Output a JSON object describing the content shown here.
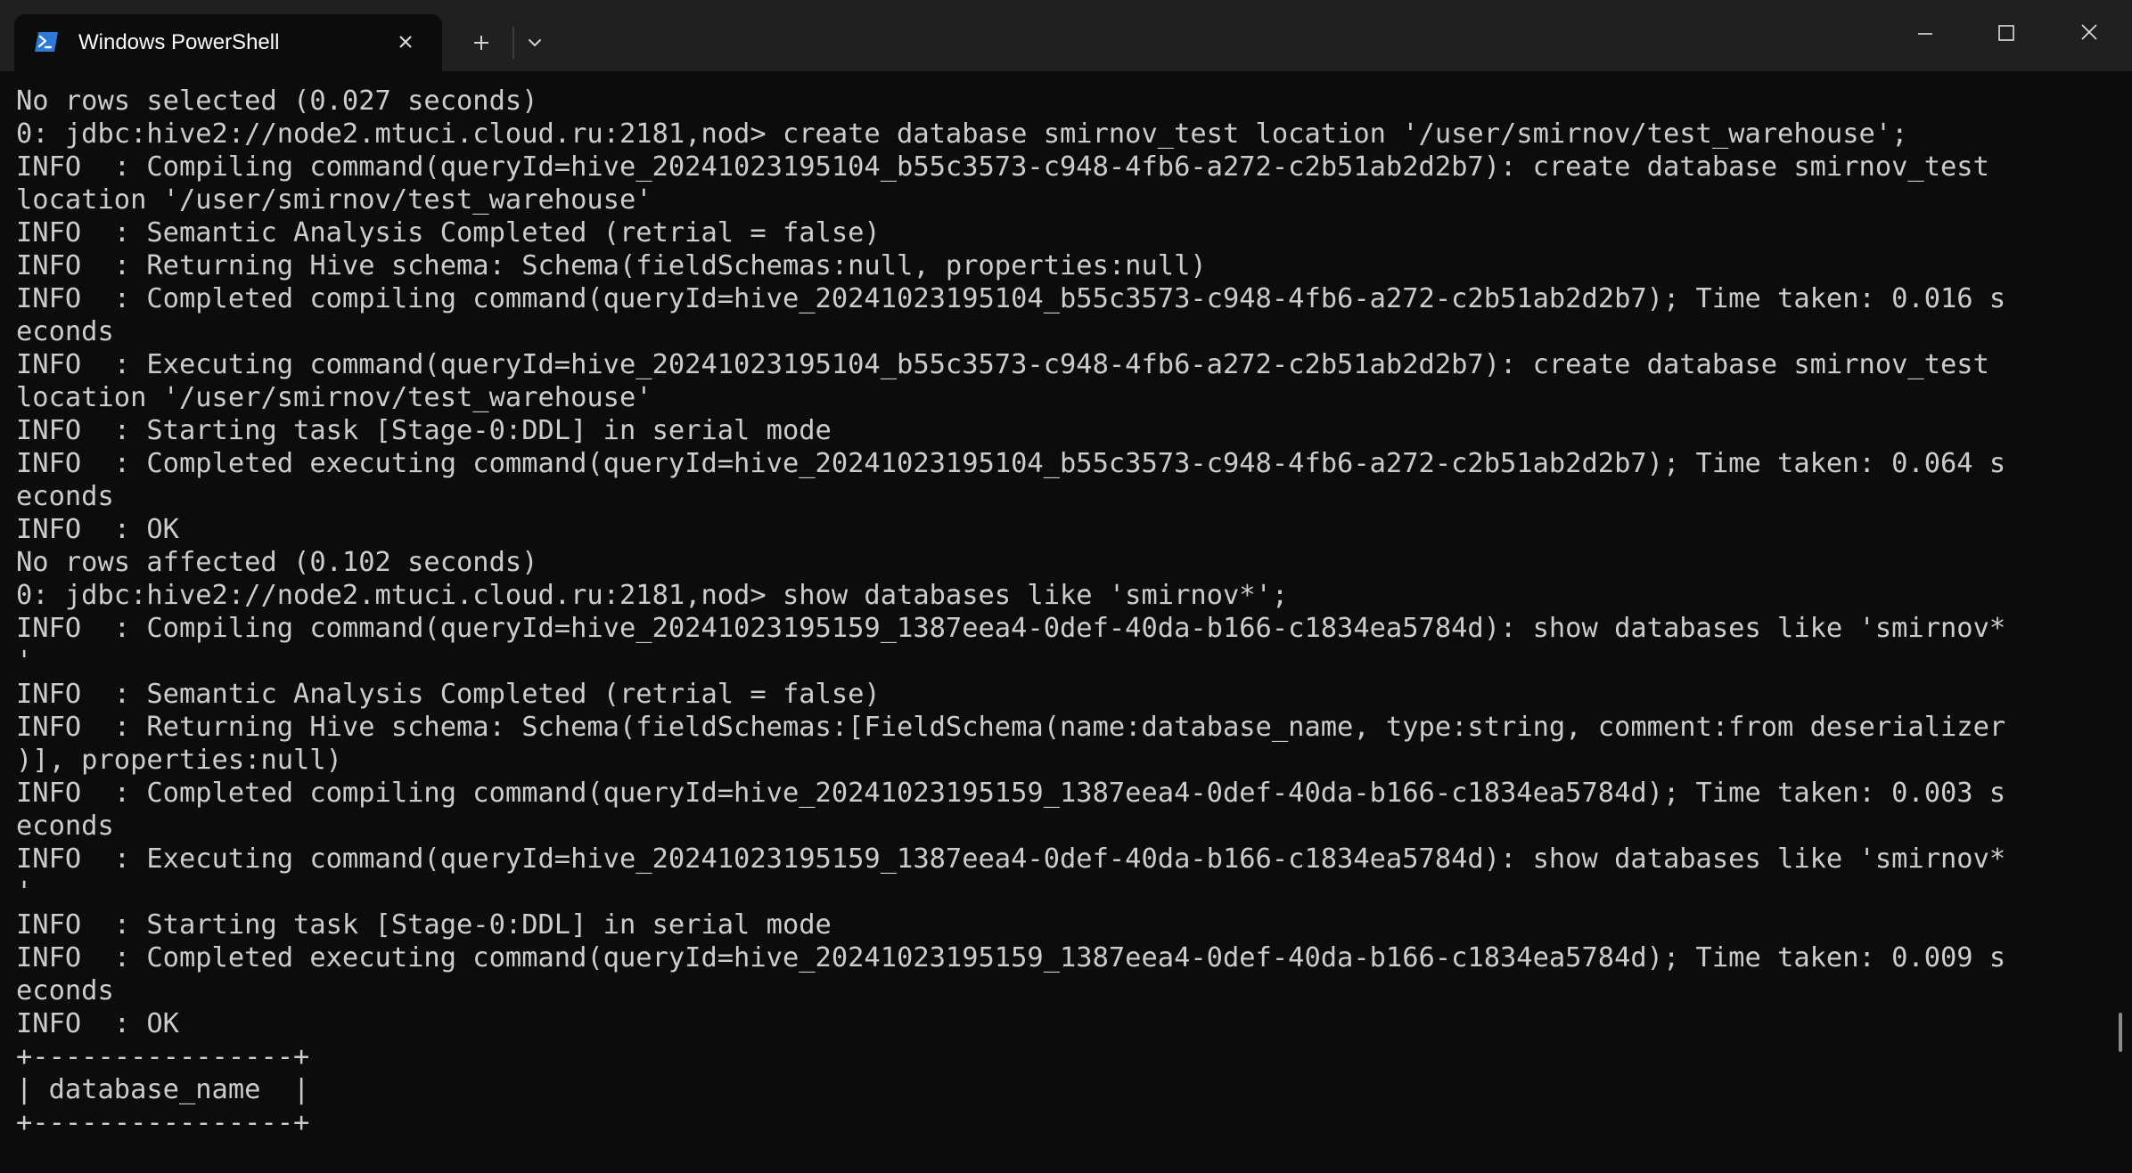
{
  "window": {
    "tab_title": "Windows PowerShell",
    "icons": {
      "tab_icon": "powershell-icon",
      "tab_close": "close-icon",
      "new_tab": "plus-icon",
      "dropdown": "chevron-down-icon",
      "minimize": "minimize-icon",
      "maximize": "maximize-icon",
      "close": "close-icon"
    },
    "colors": {
      "titlebar": "#202020",
      "terminal_bg": "#0c0c0c",
      "text": "#cccccc",
      "powershell_blue": "#2d7ad6"
    }
  },
  "terminal": {
    "lines": [
      "No rows selected (0.027 seconds)",
      "0: jdbc:hive2://node2.mtuci.cloud.ru:2181,nod> create database smirnov_test location '/user/smirnov/test_warehouse';",
      "INFO  : Compiling command(queryId=hive_20241023195104_b55c3573-c948-4fb6-a272-c2b51ab2d2b7): create database smirnov_test",
      "location '/user/smirnov/test_warehouse'",
      "INFO  : Semantic Analysis Completed (retrial = false)",
      "INFO  : Returning Hive schema: Schema(fieldSchemas:null, properties:null)",
      "INFO  : Completed compiling command(queryId=hive_20241023195104_b55c3573-c948-4fb6-a272-c2b51ab2d2b7); Time taken: 0.016 s",
      "econds",
      "INFO  : Executing command(queryId=hive_20241023195104_b55c3573-c948-4fb6-a272-c2b51ab2d2b7): create database smirnov_test",
      "location '/user/smirnov/test_warehouse'",
      "INFO  : Starting task [Stage-0:DDL] in serial mode",
      "INFO  : Completed executing command(queryId=hive_20241023195104_b55c3573-c948-4fb6-a272-c2b51ab2d2b7); Time taken: 0.064 s",
      "econds",
      "INFO  : OK",
      "No rows affected (0.102 seconds)",
      "0: jdbc:hive2://node2.mtuci.cloud.ru:2181,nod> show databases like 'smirnov*';",
      "INFO  : Compiling command(queryId=hive_20241023195159_1387eea4-0def-40da-b166-c1834ea5784d): show databases like 'smirnov*",
      "'",
      "INFO  : Semantic Analysis Completed (retrial = false)",
      "INFO  : Returning Hive schema: Schema(fieldSchemas:[FieldSchema(name:database_name, type:string, comment:from deserializer",
      ")], properties:null)",
      "INFO  : Completed compiling command(queryId=hive_20241023195159_1387eea4-0def-40da-b166-c1834ea5784d); Time taken: 0.003 s",
      "econds",
      "INFO  : Executing command(queryId=hive_20241023195159_1387eea4-0def-40da-b166-c1834ea5784d): show databases like 'smirnov*",
      "'",
      "INFO  : Starting task [Stage-0:DDL] in serial mode",
      "INFO  : Completed executing command(queryId=hive_20241023195159_1387eea4-0def-40da-b166-c1834ea5784d); Time taken: 0.009 s",
      "econds",
      "INFO  : OK",
      "+----------------+",
      "| database_name  |",
      "+----------------+"
    ]
  }
}
